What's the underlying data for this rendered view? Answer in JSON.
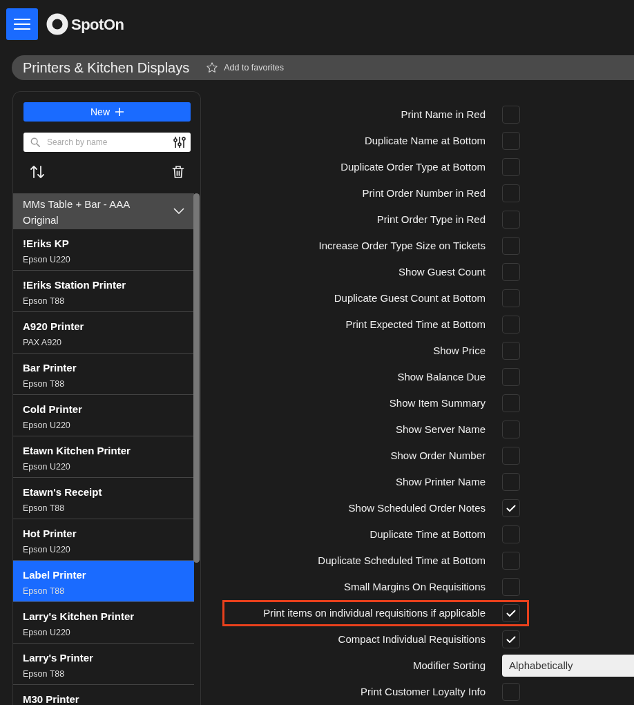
{
  "header": {
    "logo_text": "SpotOn"
  },
  "page": {
    "title": "Printers & Kitchen Displays",
    "favorite_label": "Add to favorites"
  },
  "sidebar": {
    "new_button": "New",
    "search": {
      "placeholder": "Search by name"
    },
    "group": {
      "label": "MMs Table + Bar - AAA Original",
      "expanded": true
    },
    "printers": [
      {
        "name": "!Eriks KP",
        "model": "Epson U220",
        "selected": false
      },
      {
        "name": "!Eriks Station Printer",
        "model": "Epson T88",
        "selected": false
      },
      {
        "name": "A920 Printer",
        "model": "PAX A920",
        "selected": false
      },
      {
        "name": "Bar Printer",
        "model": "Epson T88",
        "selected": false
      },
      {
        "name": "Cold Printer",
        "model": "Epson U220",
        "selected": false
      },
      {
        "name": "Etawn Kitchen Printer",
        "model": "Epson U220",
        "selected": false
      },
      {
        "name": "Etawn's Receipt",
        "model": "Epson T88",
        "selected": false
      },
      {
        "name": "Hot Printer",
        "model": "Epson U220",
        "selected": false
      },
      {
        "name": "Label Printer",
        "model": "Epson T88",
        "selected": true
      },
      {
        "name": "Larry's Kitchen Printer",
        "model": "Epson U220",
        "selected": false
      },
      {
        "name": "Larry's Printer",
        "model": "Epson T88",
        "selected": false
      },
      {
        "name": "M30 Printer",
        "selected": false
      }
    ]
  },
  "settings": [
    {
      "kind": "checkbox",
      "label": "Print Name in Red",
      "checked": false
    },
    {
      "kind": "checkbox",
      "label": "Duplicate Name at Bottom",
      "checked": false
    },
    {
      "kind": "checkbox",
      "label": "Duplicate Order Type at Bottom",
      "checked": false
    },
    {
      "kind": "checkbox",
      "label": "Print Order Number in Red",
      "checked": false
    },
    {
      "kind": "checkbox",
      "label": "Print Order Type in Red",
      "checked": false
    },
    {
      "kind": "checkbox",
      "label": "Increase Order Type Size on Tickets",
      "checked": false
    },
    {
      "kind": "checkbox",
      "label": "Show Guest Count",
      "checked": false
    },
    {
      "kind": "checkbox",
      "label": "Duplicate Guest Count at Bottom",
      "checked": false
    },
    {
      "kind": "checkbox",
      "label": "Print Expected Time at Bottom",
      "checked": false
    },
    {
      "kind": "checkbox",
      "label": "Show Price",
      "checked": false
    },
    {
      "kind": "checkbox",
      "label": "Show Balance Due",
      "checked": false
    },
    {
      "kind": "checkbox",
      "label": "Show Item Summary",
      "checked": false
    },
    {
      "kind": "checkbox",
      "label": "Show Server Name",
      "checked": false
    },
    {
      "kind": "checkbox",
      "label": "Show Order Number",
      "checked": false
    },
    {
      "kind": "checkbox",
      "label": "Show Printer Name",
      "checked": false
    },
    {
      "kind": "checkbox",
      "label": "Show Scheduled Order Notes",
      "checked": true
    },
    {
      "kind": "checkbox",
      "label": "Duplicate Time at Bottom",
      "checked": false
    },
    {
      "kind": "checkbox",
      "label": "Duplicate Scheduled Time at Bottom",
      "checked": false
    },
    {
      "kind": "checkbox",
      "label": "Small Margins On Requisitions",
      "checked": false
    },
    {
      "kind": "checkbox",
      "label": "Print items on individual requisitions if applicable",
      "checked": true,
      "highlighted": true
    },
    {
      "kind": "checkbox",
      "label": "Compact Individual Requisitions",
      "checked": true
    },
    {
      "kind": "select",
      "label": "Modifier Sorting",
      "value": "Alphabetically"
    },
    {
      "kind": "checkbox",
      "label": "Print Customer Loyalty Info",
      "checked": false
    }
  ]
}
